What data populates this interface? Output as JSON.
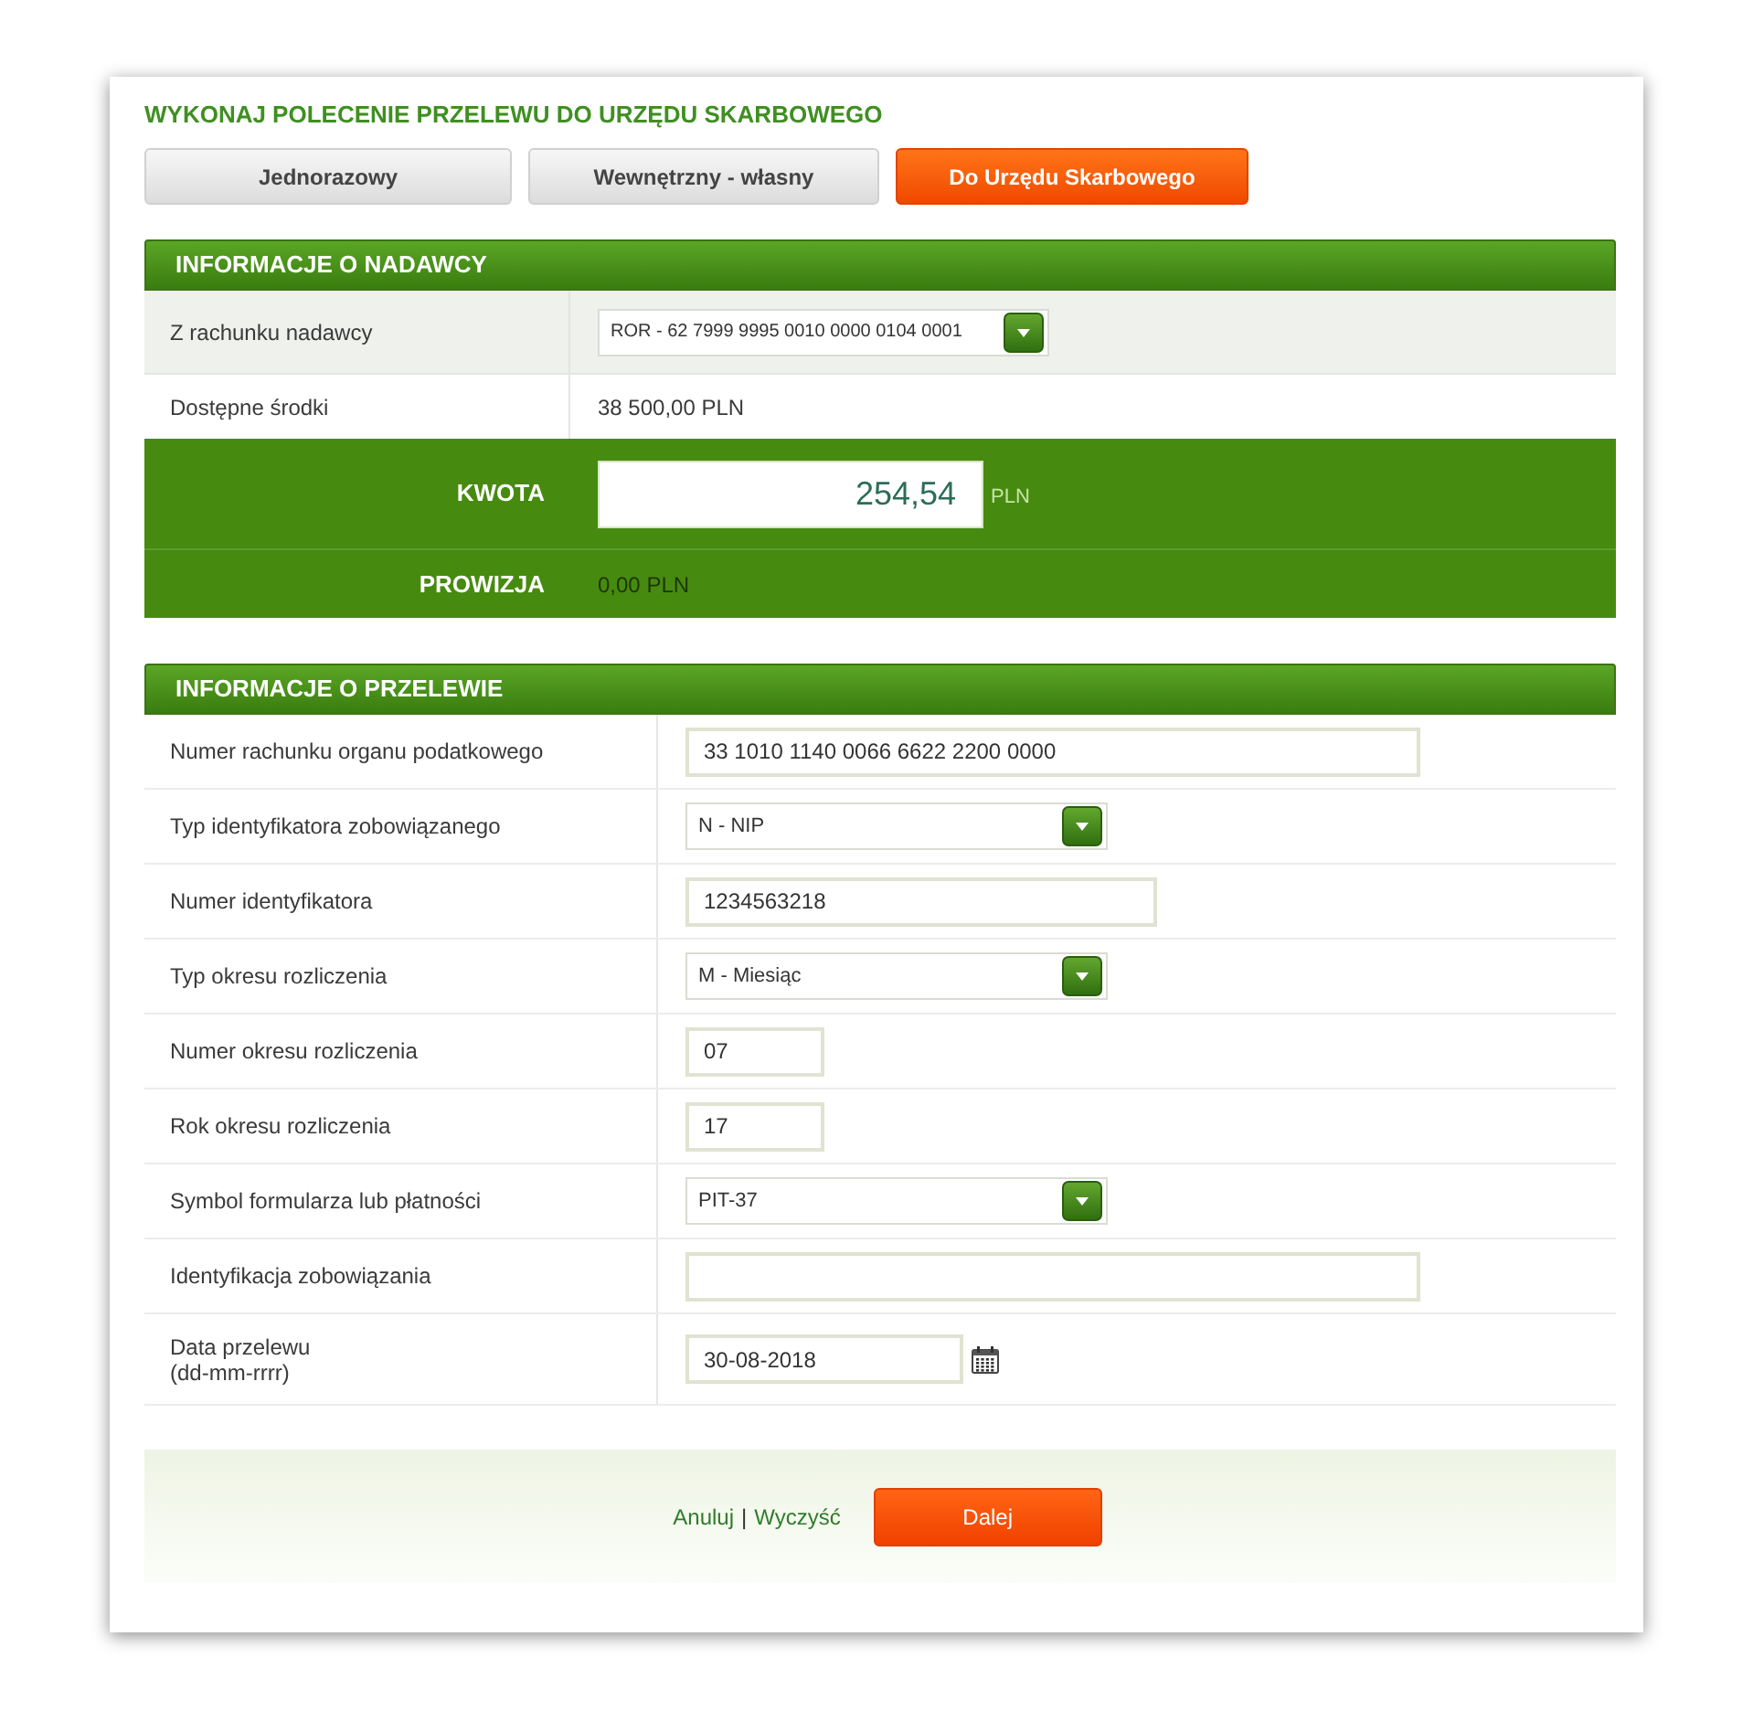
{
  "page": {
    "title": "WYKONAJ POLECENIE PRZELEWU DO URZĘDU SKARBOWEGO"
  },
  "tabs": [
    {
      "label": "Jednorazowy",
      "selected": false
    },
    {
      "label": "Wewnętrzny - własny",
      "selected": false
    },
    {
      "label": "Do Urzędu Skarbowego",
      "selected": true
    }
  ],
  "sender_section": {
    "title": "INFORMACJE O NADAWCY",
    "rows": [
      {
        "kind": "select",
        "label": "Z rachunku nadawcy",
        "value": "ROR - 62 7999 9995 0010 0000 0104 0001"
      },
      {
        "kind": "text",
        "label": "Dostępne środki",
        "value": "38 500,00 PLN"
      }
    ]
  },
  "amount": {
    "label": "KWOTA",
    "value": "254,54",
    "currency": "PLN"
  },
  "commission": {
    "label": "PROWIZJA",
    "value": "0,00 PLN"
  },
  "transfer_section": {
    "title": "INFORMACJE O PRZELEWIE",
    "rows": [
      {
        "kind": "input",
        "label": "Numer rachunku organu podatkowego",
        "value": "33 1010 1140 0066 6622 2200 0000"
      },
      {
        "kind": "select",
        "label": "Typ identyfikatora zobowiązanego",
        "value": "N - NIP"
      },
      {
        "kind": "input",
        "label": "Numer identyfikatora",
        "value": "1234563218"
      },
      {
        "kind": "select",
        "label": "Typ okresu rozliczenia",
        "value": "M - Miesiąc"
      },
      {
        "kind": "input",
        "label": "Numer okresu rozliczenia",
        "value": "07"
      },
      {
        "kind": "input",
        "label": "Rok okresu rozliczenia",
        "value": "17"
      },
      {
        "kind": "select",
        "label": "Symbol formularza lub płatności",
        "value": "PIT-37"
      },
      {
        "kind": "input",
        "label": "Identyfikacja zobowiązania"
      },
      {
        "kind": "date",
        "label": "Data przelewu",
        "format_hint": "(dd-mm-rrrr)",
        "value": "30-08-2018"
      }
    ]
  },
  "footer": {
    "links": [
      "Anuluj",
      "Wyczyść"
    ],
    "separator": "|",
    "button": "Dalej"
  }
}
